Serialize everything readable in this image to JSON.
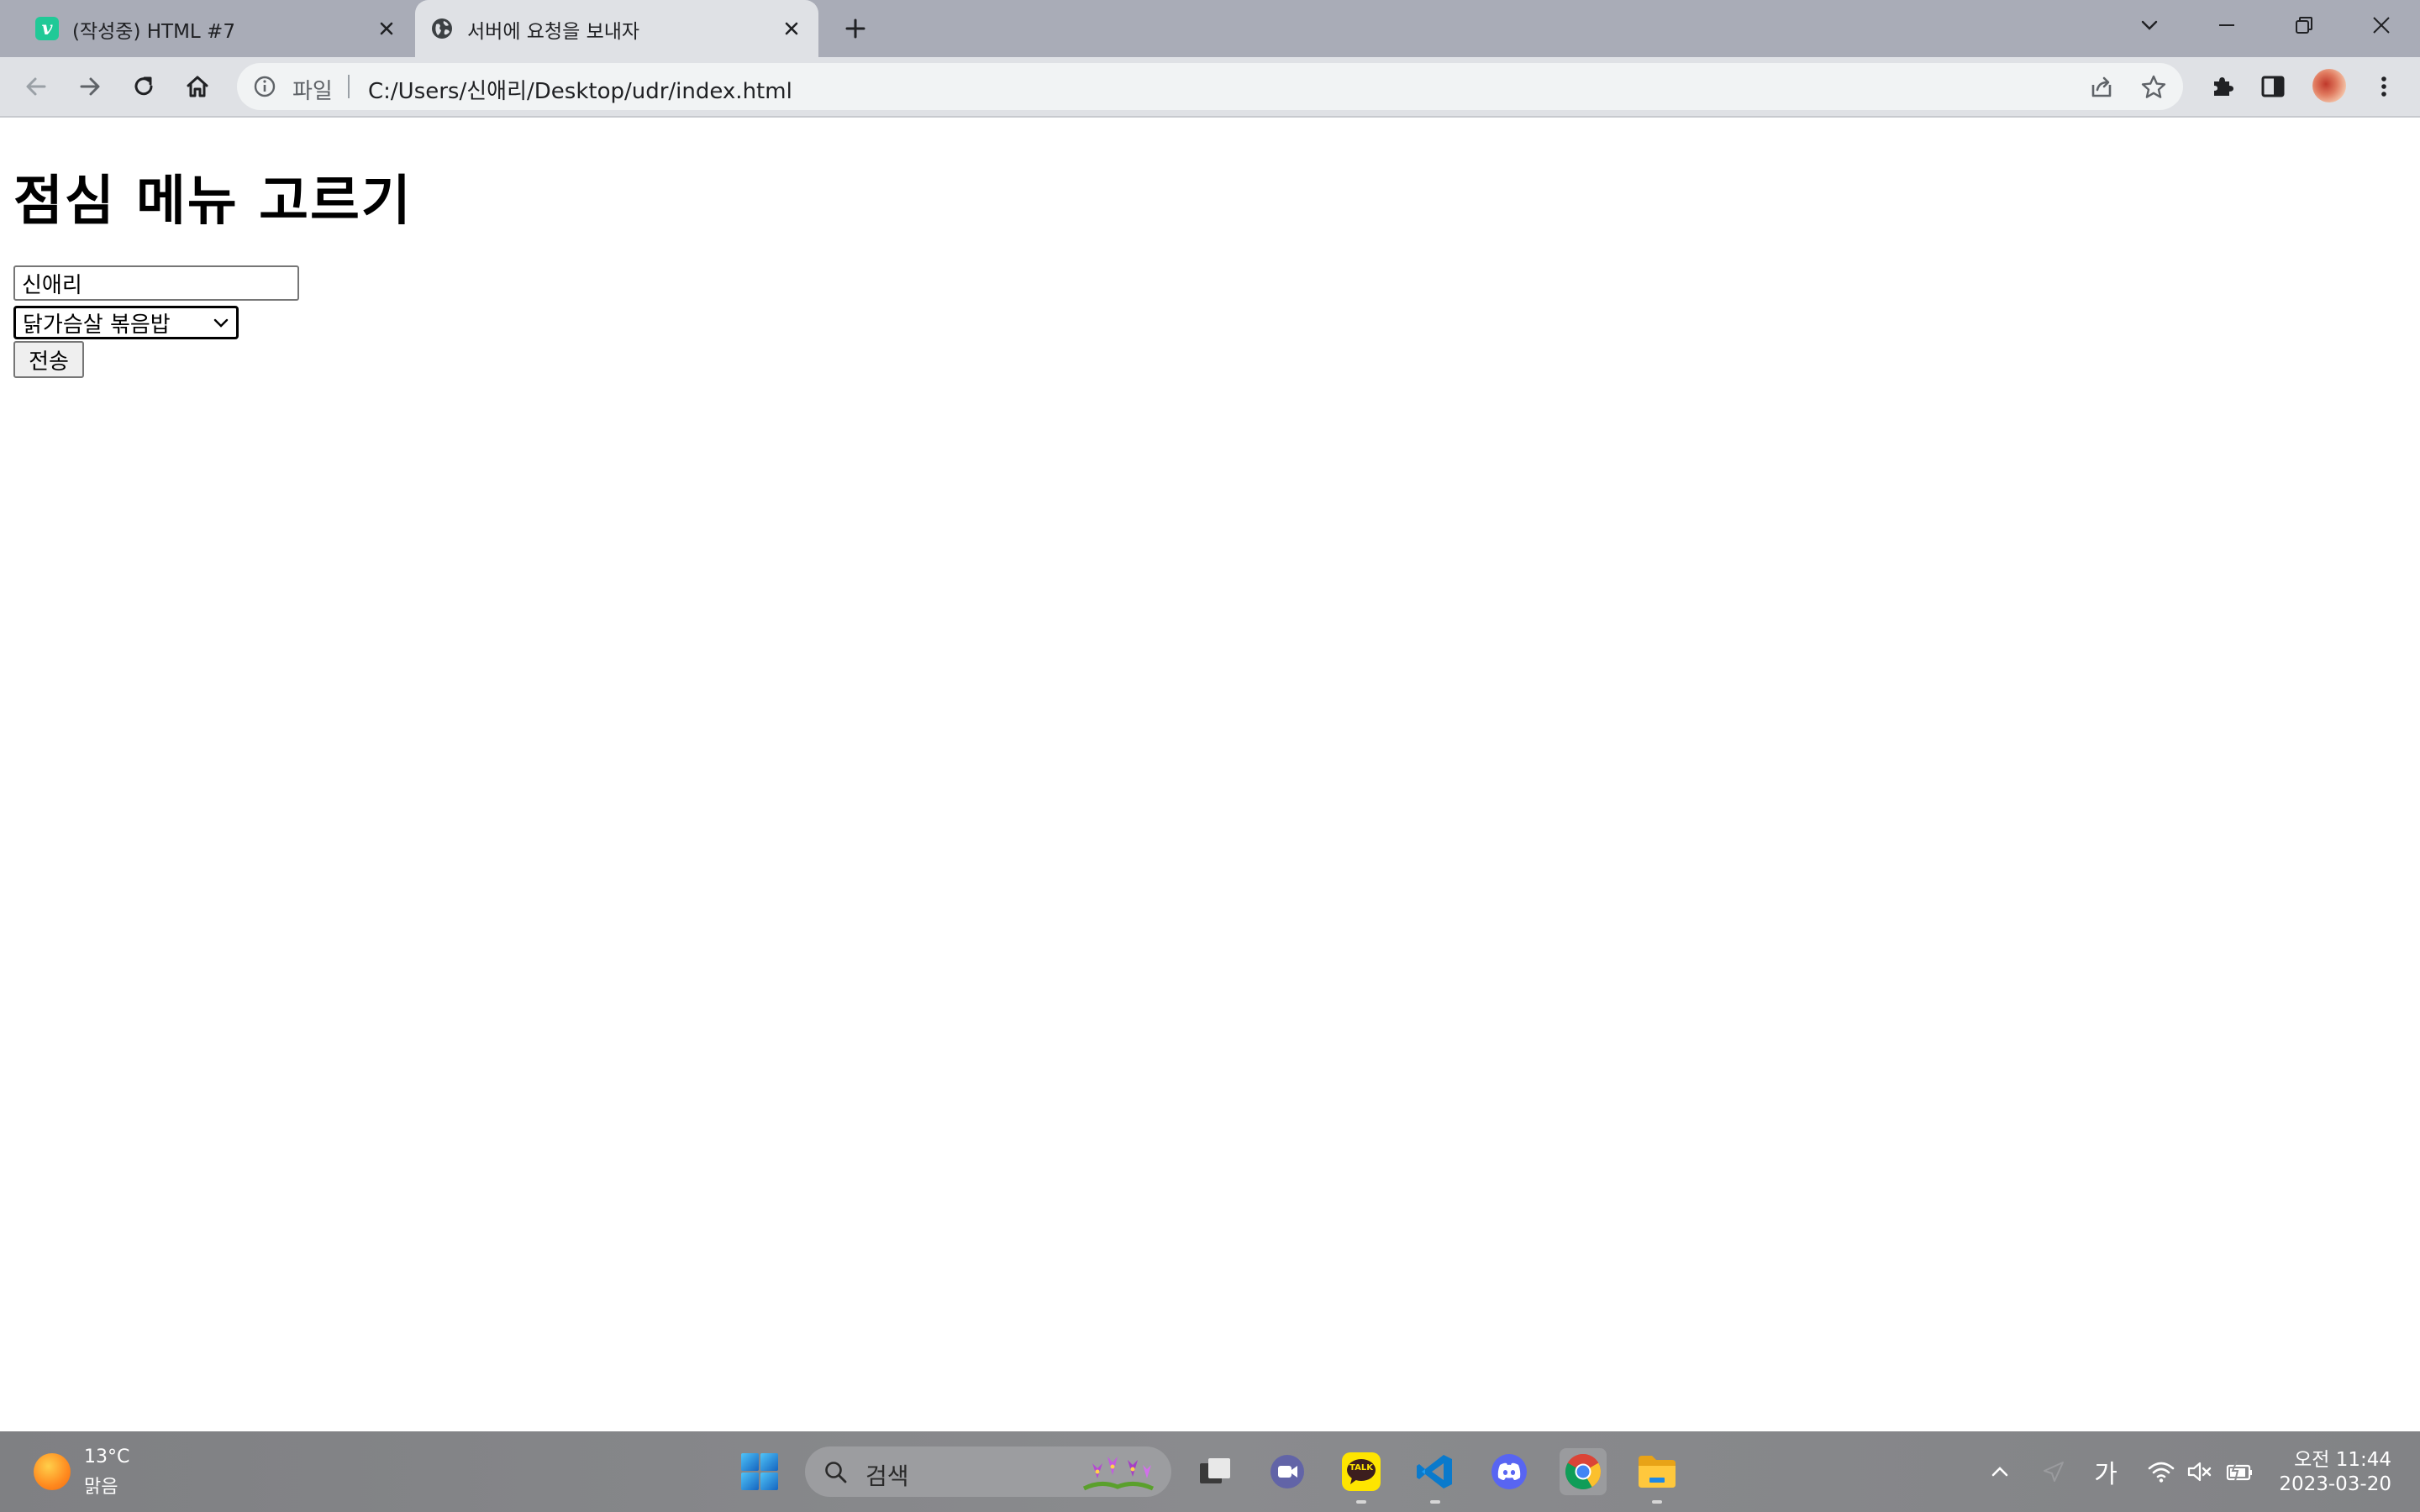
{
  "browser": {
    "tabs": [
      {
        "title": "(작성중) HTML #7",
        "favicon": "velog-icon",
        "favicon_letter": "v",
        "active": false
      },
      {
        "title": "서버에 요청을 보내자",
        "favicon": "globe-icon",
        "active": true
      }
    ],
    "address": {
      "scheme_label": "파일",
      "url": "C:/Users/신애리/Desktop/udr/index.html"
    }
  },
  "page": {
    "heading": "점심 메뉴 고르기",
    "name_value": "신애리",
    "menu_selected": "닭가슴살 볶음밥",
    "submit_label": "전송"
  },
  "taskbar": {
    "weather_temp": "13°C",
    "weather_condition": "맑음",
    "search_placeholder": "검색",
    "kakao_label": "TALK",
    "ime_indicator": "가",
    "clock_time": "오전 11:44",
    "clock_date": "2023-03-20"
  },
  "colors": {
    "tabstrip": "#a9acb7",
    "toolbar": "#dfe1e5",
    "velog_accent": "#20c997",
    "kakao_yellow": "#fee500",
    "vscode_blue": "#0a7acc",
    "discord_blurple": "#5865f2"
  }
}
